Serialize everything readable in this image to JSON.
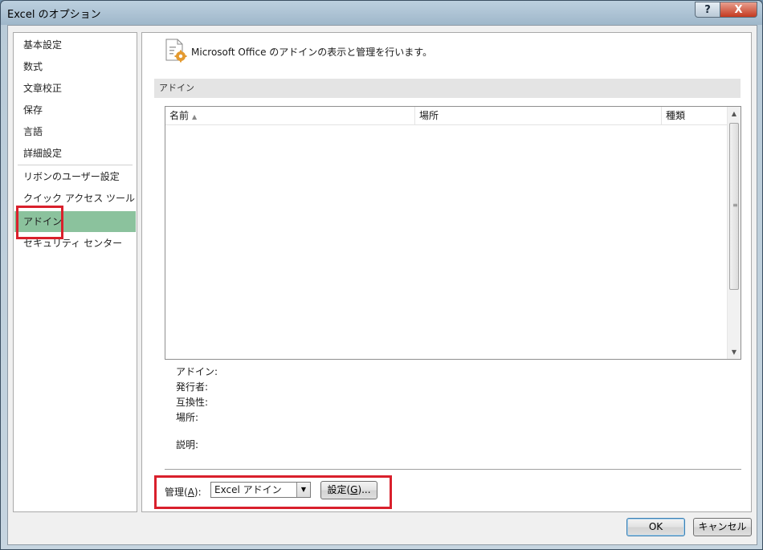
{
  "window": {
    "title": "Excel のオプション",
    "help_glyph": "?",
    "close_glyph": "X"
  },
  "sidebar": {
    "items": [
      {
        "label": "基本設定",
        "selected": false
      },
      {
        "label": "数式",
        "selected": false
      },
      {
        "label": "文章校正",
        "selected": false
      },
      {
        "label": "保存",
        "selected": false
      },
      {
        "label": "言語",
        "selected": false
      },
      {
        "label": "詳細設定",
        "selected": false
      },
      {
        "label": "リボンのユーザー設定",
        "selected": false
      },
      {
        "label": "クイック アクセス ツール バー",
        "selected": false
      },
      {
        "label": "アドイン",
        "selected": true
      },
      {
        "label": "セキュリティ センター",
        "selected": false
      }
    ]
  },
  "main": {
    "header_icon": "addin-gear-icon",
    "header_text": "Microsoft Office のアドインの表示と管理を行います。",
    "section_title": "アドイン",
    "table": {
      "columns": [
        "名前",
        "場所",
        "種類"
      ],
      "sort_column": "名前",
      "sort_direction": "ascending",
      "rows": []
    },
    "details": {
      "addin_label": "アドイン:",
      "publisher_label": "発行者:",
      "compat_label": "互換性:",
      "location_label": "場所:",
      "description_label": "説明:"
    },
    "manage": {
      "label_prefix": "管理(",
      "label_accel": "A",
      "label_suffix": "):",
      "selected": "Excel アドイン",
      "go_prefix": "設定(",
      "go_accel": "G",
      "go_suffix": ")..."
    }
  },
  "footer": {
    "ok_label": "OK",
    "cancel_label": "キャンセル"
  },
  "colors": {
    "selected_nav": "#8bc29d",
    "highlight_box": "#d9202c"
  }
}
